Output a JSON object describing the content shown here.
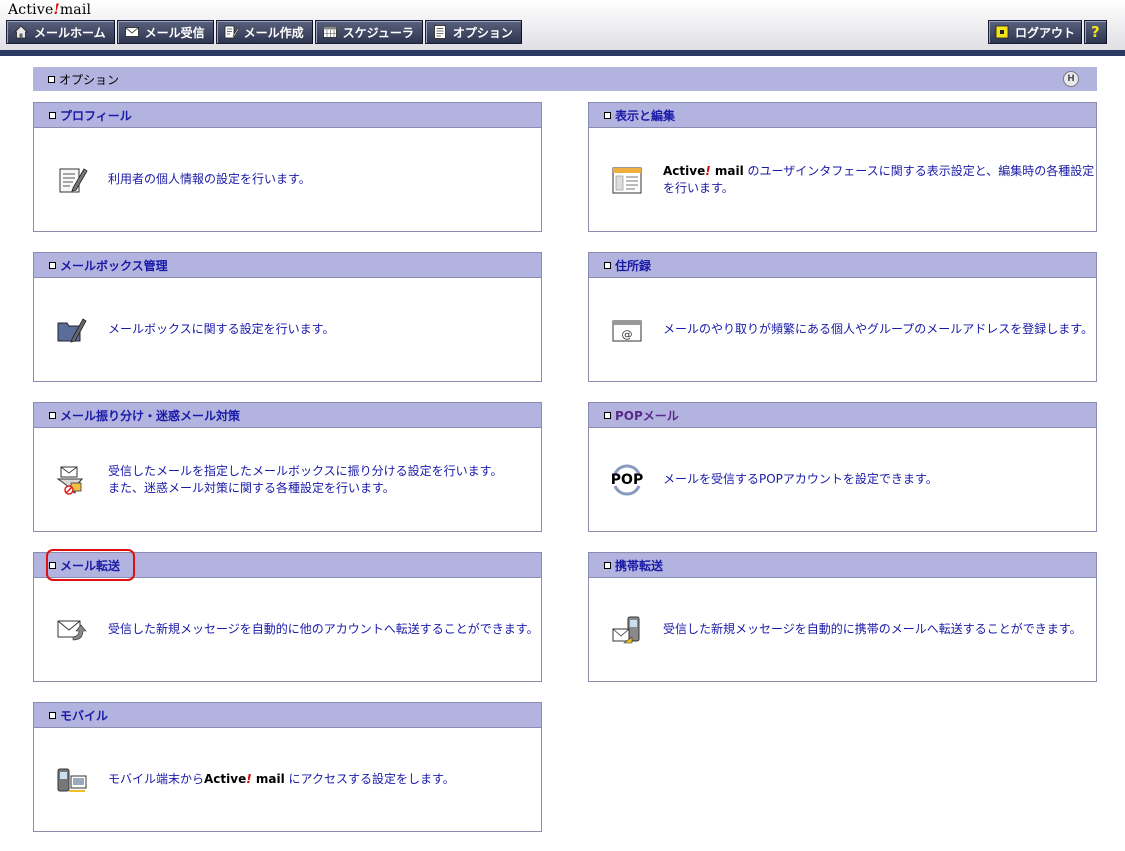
{
  "app": {
    "logo_left": "Active",
    "logo_bang": "!",
    "logo_right": "mail"
  },
  "nav": {
    "left": [
      {
        "label": "メールホーム",
        "icon": "home-icon"
      },
      {
        "label": "メール受信",
        "icon": "envelope-icon"
      },
      {
        "label": "メール作成",
        "icon": "compose-icon"
      },
      {
        "label": "スケジューラ",
        "icon": "calendar-icon"
      },
      {
        "label": "オプション",
        "icon": "options-icon"
      }
    ],
    "logout": {
      "label": "ログアウト",
      "icon": "logout-icon"
    },
    "help": {
      "label": "?"
    }
  },
  "section": {
    "title": "オプション",
    "help_icon_label": "H"
  },
  "cards": {
    "profile": {
      "title": "プロフィール",
      "desc": "利用者の個人情報の設定を行います。",
      "icon": "profile-edit-icon"
    },
    "display": {
      "title": "表示と編集",
      "desc_brand_left": "Active",
      "desc_brand_bang": "!",
      "desc_brand_right": " mail",
      "desc": " のユーザインタフェースに関する表示設定と、編集時の各種設定を行います。",
      "icon": "layout-icon"
    },
    "mailbox": {
      "title": "メールボックス管理",
      "desc": "メールボックスに関する設定を行います。",
      "icon": "folder-edit-icon"
    },
    "address": {
      "title": "住所録",
      "desc": "メールのやり取りが頻繁にある個人やグループのメールアドレスを登録します。",
      "icon": "address-book-icon"
    },
    "filter": {
      "title": "メール振り分け・迷惑メール対策",
      "desc_line1": "受信したメールを指定したメールボックスに振り分ける設定を行います。",
      "desc_line2": "また、迷惑メール対策に関する各種設定を行います。",
      "icon": "filter-icon"
    },
    "pop": {
      "title": "POPメール",
      "desc": "メールを受信するPOPアカウントを設定できます。",
      "icon": "pop-icon",
      "icon_text": "POP"
    },
    "forward": {
      "title": "メール転送",
      "desc": "受信した新規メッセージを自動的に他のアカウントへ転送することができます。",
      "icon": "mail-forward-icon"
    },
    "mobile_forward": {
      "title": "携帯転送",
      "desc": "受信した新規メッセージを自動的に携帯のメールへ転送することができます。",
      "icon": "mobile-forward-icon"
    },
    "mobile": {
      "title": "モバイル",
      "desc_pre": "モバイル端末から",
      "desc_brand_left": "Active",
      "desc_brand_bang": "!",
      "desc_brand_right": " mail",
      "desc_post": " にアクセスする設定をします。",
      "icon": "mobile-icon"
    }
  },
  "colors": {
    "header_dark": "#2e3a66",
    "title_bar": "#b3b3df",
    "link": "#1a1aa8",
    "highlight": "#e01010"
  }
}
